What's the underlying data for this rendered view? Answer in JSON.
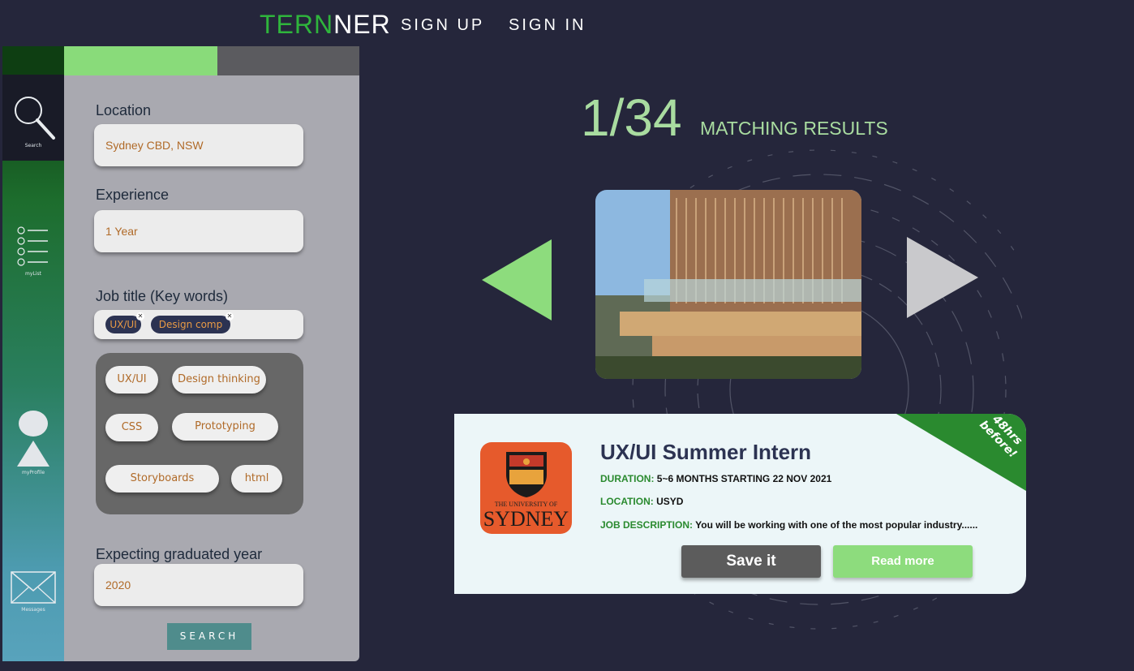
{
  "nav": {
    "logo_part1": "TERN",
    "logo_part2": "NER",
    "sign_up": "SIGN UP",
    "sign_in": "SIGN IN"
  },
  "sidebar": {
    "items": [
      {
        "label": "Search",
        "icon": "search-icon"
      },
      {
        "label": "myList",
        "icon": "list-icon"
      },
      {
        "label": "myProfile",
        "icon": "profile-icon"
      },
      {
        "label": "Messages",
        "icon": "envelope-icon"
      }
    ]
  },
  "filters": {
    "progress": 0.52,
    "location_label": "Location",
    "location_value": "Sydney CBD, NSW",
    "experience_label": "Experience",
    "experience_value": "1 Year",
    "job_title_label": "Job title (Key words)",
    "selected_keywords": [
      "UX/UI",
      "Design comp"
    ],
    "suggested_keywords": [
      "UX/UI",
      "Design thinking",
      "CSS",
      "Prototyping",
      "Storyboards",
      "html"
    ],
    "grad_year_label": "Expecting graduated year",
    "grad_year_value": "2020",
    "search_button": "SEARCH"
  },
  "results": {
    "count": "1/34",
    "label": "MATCHING RESULTS"
  },
  "card": {
    "ribbon": "48hrs before!",
    "logo_line1": "THE UNIVERSITY OF",
    "logo_line2": "SYDNEY",
    "title": "UX/UI Summer Intern",
    "duration_key": "DURATION:",
    "duration_value": "5~6 MONTHS  STARTING 22 NOV 2021",
    "location_key": "LOCATION:",
    "location_value": "USYD",
    "description_key": "JOB DESCRIPTION:",
    "description_value": "You will be working with one of the most popular industry......",
    "save_button": "Save it",
    "read_button": "Read more"
  },
  "colors": {
    "background": "#25263b",
    "accent_green": "#8ddc7d",
    "logo_green": "#2fb53c",
    "panel": "#a9a9b0",
    "ribbon": "#2a8a2f"
  }
}
